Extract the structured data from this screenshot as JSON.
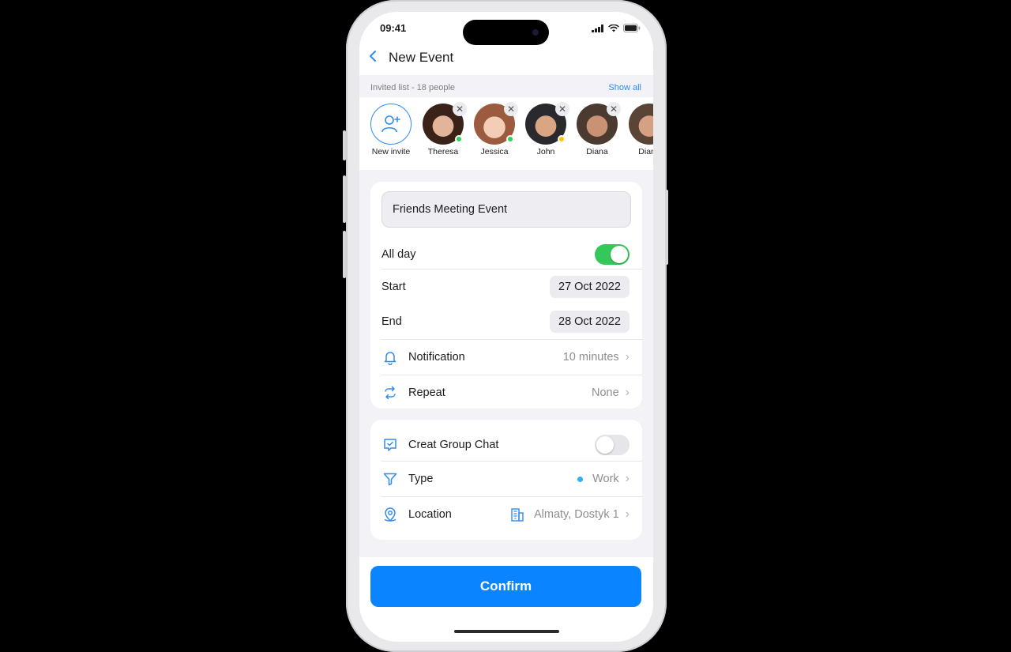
{
  "status": {
    "time": "09:41"
  },
  "header": {
    "title": "New Event"
  },
  "invited": {
    "summary": "Invited list - 18 people",
    "show_all": "Show all",
    "new_invite": "New invite",
    "people": [
      {
        "name": "Theresa",
        "status_color": "#2fd158"
      },
      {
        "name": "Jessica",
        "status_color": "#2fd158"
      },
      {
        "name": "John",
        "status_color": "#ffc400"
      },
      {
        "name": "Diana",
        "status_color": null
      },
      {
        "name": "Diana",
        "status_color": null
      }
    ]
  },
  "event": {
    "name": "Friends Meeting Event",
    "all_day_label": "All day",
    "all_day": true,
    "start_label": "Start",
    "start_value": "27 Oct 2022",
    "end_label": "End",
    "end_value": "28 Oct 2022",
    "notification_label": "Notification",
    "notification_value": "10 minutes",
    "repeat_label": "Repeat",
    "repeat_value": "None"
  },
  "options": {
    "group_chat_label": "Creat Group Chat",
    "group_chat": false,
    "type_label": "Type",
    "type_value": "Work",
    "location_label": "Location",
    "location_value": "Almaty, Dostyk 1"
  },
  "confirm_label": "Confirm",
  "colors": {
    "accent": "#0a84ff",
    "toggle_on": "#34c759",
    "toggle_off": "#e5e5ea"
  }
}
